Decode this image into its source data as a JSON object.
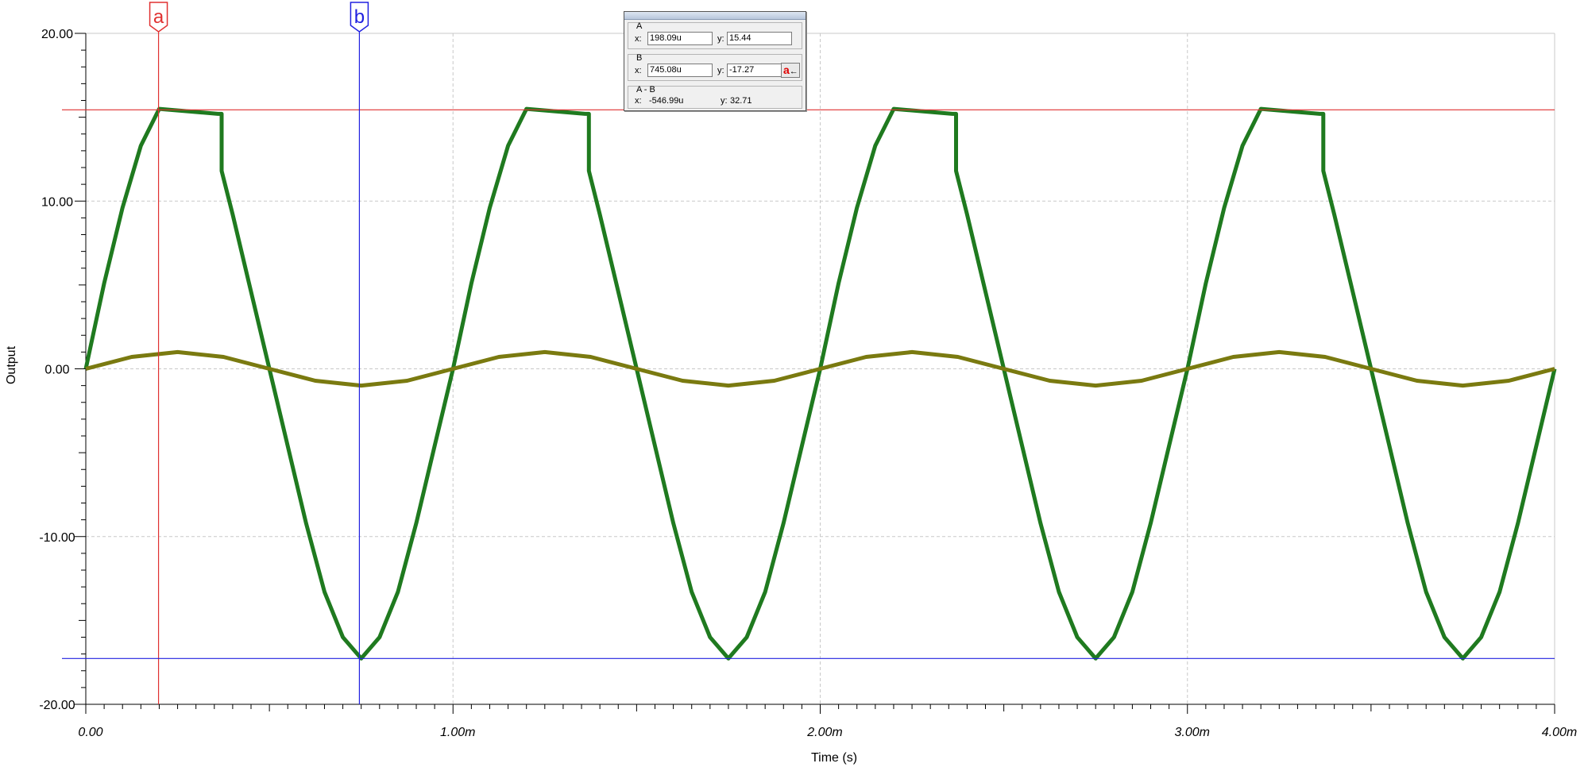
{
  "chart_data": {
    "type": "line",
    "xlabel": "Time (s)",
    "ylabel": "Output",
    "xlim": [
      0,
      0.004
    ],
    "ylim": [
      -20,
      20
    ],
    "x_ticks": [
      {
        "value": 0,
        "label": "0.00"
      },
      {
        "value": 0.001,
        "label": "1.00m"
      },
      {
        "value": 0.002,
        "label": "2.00m"
      },
      {
        "value": 0.003,
        "label": "3.00m"
      },
      {
        "value": 0.004,
        "label": "4.00m"
      }
    ],
    "y_ticks": [
      {
        "value": 20,
        "label": "20.00"
      },
      {
        "value": 10,
        "label": "10.00"
      },
      {
        "value": 0,
        "label": "0.00"
      },
      {
        "value": -10,
        "label": "-10.00"
      },
      {
        "value": -20,
        "label": "-20.00"
      }
    ],
    "grid": true,
    "series": [
      {
        "color": "#1f7a1f",
        "points": [
          [
            0,
            0
          ],
          [
            5e-05,
            5.1
          ],
          [
            0.0001,
            9.6
          ],
          [
            0.00015,
            13.3
          ],
          [
            0.0002,
            15.5
          ],
          [
            0.00036,
            15.2
          ],
          [
            0.00037,
            15.2
          ],
          [
            0.00037,
            11.8
          ],
          [
            0.0004,
            9.2
          ],
          [
            0.00045,
            4.6
          ],
          [
            0.0005,
            0.0
          ],
          [
            0.00055,
            -4.6
          ],
          [
            0.0006,
            -9.2
          ],
          [
            0.00065,
            -13.3
          ],
          [
            0.0007,
            -16.0
          ],
          [
            0.00075,
            -17.27
          ],
          [
            0.0008,
            -16.0
          ],
          [
            0.00085,
            -13.3
          ],
          [
            0.0009,
            -9.2
          ],
          [
            0.00095,
            -4.6
          ],
          [
            0.001,
            0
          ],
          [
            0.00105,
            5.1
          ],
          [
            0.0011,
            9.6
          ],
          [
            0.00115,
            13.3
          ],
          [
            0.0012,
            15.5
          ],
          [
            0.00136,
            15.2
          ],
          [
            0.00137,
            15.2
          ],
          [
            0.00137,
            11.8
          ],
          [
            0.0014,
            9.2
          ],
          [
            0.00145,
            4.6
          ],
          [
            0.0015,
            0.0
          ],
          [
            0.00155,
            -4.6
          ],
          [
            0.0016,
            -9.2
          ],
          [
            0.00165,
            -13.3
          ],
          [
            0.0017,
            -16.0
          ],
          [
            0.00175,
            -17.27
          ],
          [
            0.0018,
            -16.0
          ],
          [
            0.00185,
            -13.3
          ],
          [
            0.0019,
            -9.2
          ],
          [
            0.00195,
            -4.6
          ],
          [
            0.002,
            0
          ],
          [
            0.00205,
            5.1
          ],
          [
            0.0021,
            9.6
          ],
          [
            0.00215,
            13.3
          ],
          [
            0.0022,
            15.5
          ],
          [
            0.00236,
            15.2
          ],
          [
            0.00237,
            15.2
          ],
          [
            0.00237,
            11.8
          ],
          [
            0.0024,
            9.2
          ],
          [
            0.00245,
            4.6
          ],
          [
            0.0025,
            0.0
          ],
          [
            0.00255,
            -4.6
          ],
          [
            0.0026,
            -9.2
          ],
          [
            0.00265,
            -13.3
          ],
          [
            0.0027,
            -16.0
          ],
          [
            0.00275,
            -17.27
          ],
          [
            0.0028,
            -16.0
          ],
          [
            0.00285,
            -13.3
          ],
          [
            0.0029,
            -9.2
          ],
          [
            0.00295,
            -4.6
          ],
          [
            0.003,
            0
          ],
          [
            0.00305,
            5.1
          ],
          [
            0.0031,
            9.6
          ],
          [
            0.00315,
            13.3
          ],
          [
            0.0032,
            15.5
          ],
          [
            0.00336,
            15.2
          ],
          [
            0.00337,
            15.2
          ],
          [
            0.00337,
            11.8
          ],
          [
            0.0034,
            9.2
          ],
          [
            0.00345,
            4.6
          ],
          [
            0.0035,
            0.0
          ],
          [
            0.00355,
            -4.6
          ],
          [
            0.0036,
            -9.2
          ],
          [
            0.00365,
            -13.3
          ],
          [
            0.0037,
            -16.0
          ],
          [
            0.00375,
            -17.27
          ],
          [
            0.0038,
            -16.0
          ],
          [
            0.00385,
            -13.3
          ],
          [
            0.0039,
            -9.2
          ],
          [
            0.00395,
            -4.6
          ],
          [
            0.004,
            0
          ]
        ]
      },
      {
        "color": "#7a7a10",
        "amplitude": 1.0,
        "frequency_hz": 1000,
        "points": [
          [
            0,
            0
          ],
          [
            0.000125,
            0.71
          ],
          [
            0.00025,
            1.0
          ],
          [
            0.000375,
            0.71
          ],
          [
            0.0005,
            0
          ],
          [
            0.000625,
            -0.71
          ],
          [
            0.00075,
            -1.0
          ],
          [
            0.000875,
            -0.71
          ],
          [
            0.001,
            0
          ],
          [
            0.001125,
            0.71
          ],
          [
            0.00125,
            1.0
          ],
          [
            0.001375,
            0.71
          ],
          [
            0.0015,
            0
          ],
          [
            0.001625,
            -0.71
          ],
          [
            0.00175,
            -1.0
          ],
          [
            0.001875,
            -0.71
          ],
          [
            0.002,
            0
          ],
          [
            0.002125,
            0.71
          ],
          [
            0.00225,
            1.0
          ],
          [
            0.002375,
            0.71
          ],
          [
            0.0025,
            0
          ],
          [
            0.002625,
            -0.71
          ],
          [
            0.00275,
            -1.0
          ],
          [
            0.002875,
            -0.71
          ],
          [
            0.003,
            0
          ],
          [
            0.003125,
            0.71
          ],
          [
            0.00325,
            1.0
          ],
          [
            0.003375,
            0.71
          ],
          [
            0.0035,
            0
          ],
          [
            0.003625,
            -0.71
          ],
          [
            0.00375,
            -1.0
          ],
          [
            0.003875,
            -0.71
          ],
          [
            0.004,
            0
          ]
        ]
      }
    ],
    "cursors": [
      {
        "id": "a",
        "label": "a",
        "x": 0.00019809,
        "y": 15.44,
        "color": "#e03030"
      },
      {
        "id": "b",
        "label": "b",
        "x": 0.00074508,
        "y": -17.27,
        "color": "#2020e0"
      }
    ]
  },
  "readout": {
    "a": {
      "name": "A",
      "x_label": "x:",
      "x_value": "198.09u",
      "y_label": "y:",
      "y_value": "15.44"
    },
    "b": {
      "name": "B",
      "x_label": "x:",
      "x_value": "745.08u",
      "y_label": "y:",
      "y_value": "-17.27",
      "button_label": "a"
    },
    "diff": {
      "name": "A - B",
      "x_label": "x:",
      "x_value": "-546.99u",
      "y_label": "y:",
      "y_value": "32.71"
    }
  },
  "colors": {
    "grid": "#c8c8c8",
    "axis": "#000000"
  }
}
